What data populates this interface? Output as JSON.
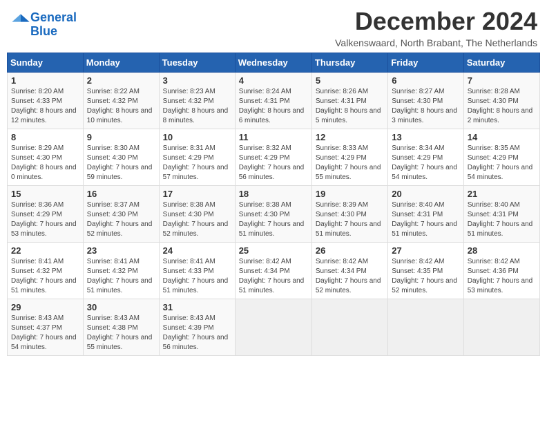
{
  "header": {
    "logo_line1": "General",
    "logo_line2": "Blue",
    "title": "December 2024",
    "location": "Valkenswaard, North Brabant, The Netherlands"
  },
  "weekdays": [
    "Sunday",
    "Monday",
    "Tuesday",
    "Wednesday",
    "Thursday",
    "Friday",
    "Saturday"
  ],
  "weeks": [
    [
      {
        "day": "1",
        "sunrise": "Sunrise: 8:20 AM",
        "sunset": "Sunset: 4:33 PM",
        "daylight": "Daylight: 8 hours and 12 minutes."
      },
      {
        "day": "2",
        "sunrise": "Sunrise: 8:22 AM",
        "sunset": "Sunset: 4:32 PM",
        "daylight": "Daylight: 8 hours and 10 minutes."
      },
      {
        "day": "3",
        "sunrise": "Sunrise: 8:23 AM",
        "sunset": "Sunset: 4:32 PM",
        "daylight": "Daylight: 8 hours and 8 minutes."
      },
      {
        "day": "4",
        "sunrise": "Sunrise: 8:24 AM",
        "sunset": "Sunset: 4:31 PM",
        "daylight": "Daylight: 8 hours and 6 minutes."
      },
      {
        "day": "5",
        "sunrise": "Sunrise: 8:26 AM",
        "sunset": "Sunset: 4:31 PM",
        "daylight": "Daylight: 8 hours and 5 minutes."
      },
      {
        "day": "6",
        "sunrise": "Sunrise: 8:27 AM",
        "sunset": "Sunset: 4:30 PM",
        "daylight": "Daylight: 8 hours and 3 minutes."
      },
      {
        "day": "7",
        "sunrise": "Sunrise: 8:28 AM",
        "sunset": "Sunset: 4:30 PM",
        "daylight": "Daylight: 8 hours and 2 minutes."
      }
    ],
    [
      {
        "day": "8",
        "sunrise": "Sunrise: 8:29 AM",
        "sunset": "Sunset: 4:30 PM",
        "daylight": "Daylight: 8 hours and 0 minutes."
      },
      {
        "day": "9",
        "sunrise": "Sunrise: 8:30 AM",
        "sunset": "Sunset: 4:30 PM",
        "daylight": "Daylight: 7 hours and 59 minutes."
      },
      {
        "day": "10",
        "sunrise": "Sunrise: 8:31 AM",
        "sunset": "Sunset: 4:29 PM",
        "daylight": "Daylight: 7 hours and 57 minutes."
      },
      {
        "day": "11",
        "sunrise": "Sunrise: 8:32 AM",
        "sunset": "Sunset: 4:29 PM",
        "daylight": "Daylight: 7 hours and 56 minutes."
      },
      {
        "day": "12",
        "sunrise": "Sunrise: 8:33 AM",
        "sunset": "Sunset: 4:29 PM",
        "daylight": "Daylight: 7 hours and 55 minutes."
      },
      {
        "day": "13",
        "sunrise": "Sunrise: 8:34 AM",
        "sunset": "Sunset: 4:29 PM",
        "daylight": "Daylight: 7 hours and 54 minutes."
      },
      {
        "day": "14",
        "sunrise": "Sunrise: 8:35 AM",
        "sunset": "Sunset: 4:29 PM",
        "daylight": "Daylight: 7 hours and 54 minutes."
      }
    ],
    [
      {
        "day": "15",
        "sunrise": "Sunrise: 8:36 AM",
        "sunset": "Sunset: 4:29 PM",
        "daylight": "Daylight: 7 hours and 53 minutes."
      },
      {
        "day": "16",
        "sunrise": "Sunrise: 8:37 AM",
        "sunset": "Sunset: 4:30 PM",
        "daylight": "Daylight: 7 hours and 52 minutes."
      },
      {
        "day": "17",
        "sunrise": "Sunrise: 8:38 AM",
        "sunset": "Sunset: 4:30 PM",
        "daylight": "Daylight: 7 hours and 52 minutes."
      },
      {
        "day": "18",
        "sunrise": "Sunrise: 8:38 AM",
        "sunset": "Sunset: 4:30 PM",
        "daylight": "Daylight: 7 hours and 51 minutes."
      },
      {
        "day": "19",
        "sunrise": "Sunrise: 8:39 AM",
        "sunset": "Sunset: 4:30 PM",
        "daylight": "Daylight: 7 hours and 51 minutes."
      },
      {
        "day": "20",
        "sunrise": "Sunrise: 8:40 AM",
        "sunset": "Sunset: 4:31 PM",
        "daylight": "Daylight: 7 hours and 51 minutes."
      },
      {
        "day": "21",
        "sunrise": "Sunrise: 8:40 AM",
        "sunset": "Sunset: 4:31 PM",
        "daylight": "Daylight: 7 hours and 51 minutes."
      }
    ],
    [
      {
        "day": "22",
        "sunrise": "Sunrise: 8:41 AM",
        "sunset": "Sunset: 4:32 PM",
        "daylight": "Daylight: 7 hours and 51 minutes."
      },
      {
        "day": "23",
        "sunrise": "Sunrise: 8:41 AM",
        "sunset": "Sunset: 4:32 PM",
        "daylight": "Daylight: 7 hours and 51 minutes."
      },
      {
        "day": "24",
        "sunrise": "Sunrise: 8:41 AM",
        "sunset": "Sunset: 4:33 PM",
        "daylight": "Daylight: 7 hours and 51 minutes."
      },
      {
        "day": "25",
        "sunrise": "Sunrise: 8:42 AM",
        "sunset": "Sunset: 4:34 PM",
        "daylight": "Daylight: 7 hours and 51 minutes."
      },
      {
        "day": "26",
        "sunrise": "Sunrise: 8:42 AM",
        "sunset": "Sunset: 4:34 PM",
        "daylight": "Daylight: 7 hours and 52 minutes."
      },
      {
        "day": "27",
        "sunrise": "Sunrise: 8:42 AM",
        "sunset": "Sunset: 4:35 PM",
        "daylight": "Daylight: 7 hours and 52 minutes."
      },
      {
        "day": "28",
        "sunrise": "Sunrise: 8:42 AM",
        "sunset": "Sunset: 4:36 PM",
        "daylight": "Daylight: 7 hours and 53 minutes."
      }
    ],
    [
      {
        "day": "29",
        "sunrise": "Sunrise: 8:43 AM",
        "sunset": "Sunset: 4:37 PM",
        "daylight": "Daylight: 7 hours and 54 minutes."
      },
      {
        "day": "30",
        "sunrise": "Sunrise: 8:43 AM",
        "sunset": "Sunset: 4:38 PM",
        "daylight": "Daylight: 7 hours and 55 minutes."
      },
      {
        "day": "31",
        "sunrise": "Sunrise: 8:43 AM",
        "sunset": "Sunset: 4:39 PM",
        "daylight": "Daylight: 7 hours and 56 minutes."
      },
      null,
      null,
      null,
      null
    ]
  ]
}
